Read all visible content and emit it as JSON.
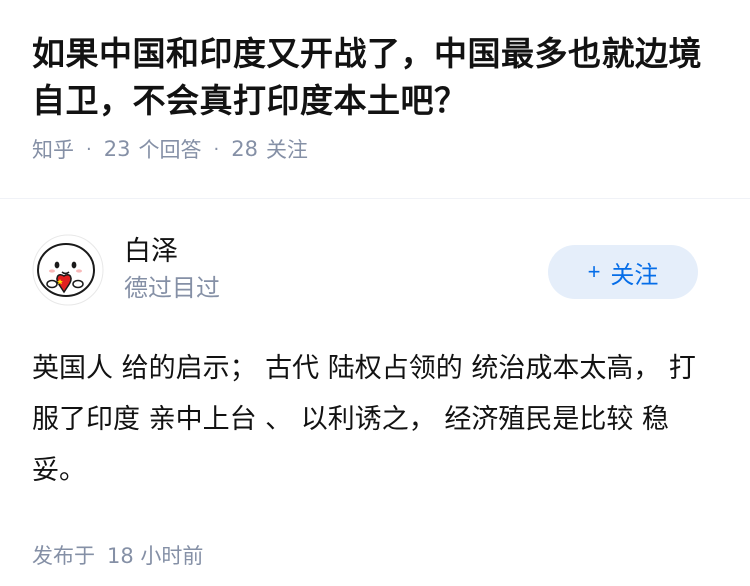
{
  "question": {
    "title": "如果中国和印度又开战了，中国最多也就边境自卫，不会真打印度本土吧？",
    "source": "知乎",
    "answer_count": "23",
    "answer_unit": "个回答",
    "follow_count": "28",
    "follow_unit": "关注",
    "separator": "·"
  },
  "answer": {
    "author_name": "白泽",
    "author_bio": "德过目过",
    "follow_button": {
      "plus": "+",
      "label": "关注"
    },
    "content": "英国人 给的启示； 古代 陆权占领的 统治成本太高， 打服了印度 亲中上台 、 以利诱之， 经济殖民是比较 稳妥。",
    "publish_label": "发布于",
    "publish_time": "18 小时前"
  },
  "icons": {
    "avatar": "cartoon-seal-with-china-flag-heart",
    "follow": "plus-icon"
  },
  "colors": {
    "accent": "#056de8",
    "accent_bg": "#e5eefa",
    "meta": "#8590a6",
    "text": "#121212"
  }
}
